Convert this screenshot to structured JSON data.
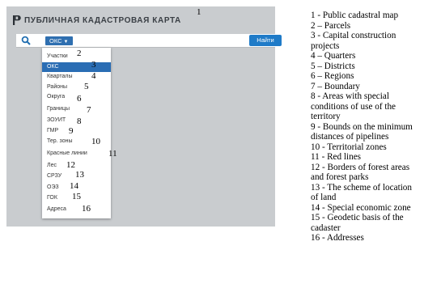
{
  "app": {
    "title": "ПУБЛИЧНАЯ КАДАСТРОВАЯ КАРТА",
    "title_callout": "1"
  },
  "search": {
    "selected_layer": "ОКС",
    "input_value": "",
    "button_label": "Найти"
  },
  "colors": {
    "panel_bg": "#c9cccf",
    "accent": "#1f7bc8",
    "selected_item_bg": "#2a6db4"
  },
  "dropdown": {
    "items": [
      {
        "label": "Участки",
        "callout": "2",
        "selected": false
      },
      {
        "label": "ОКС",
        "callout": "3",
        "selected": true
      },
      {
        "label": "Кварталы",
        "callout": "4",
        "selected": false
      },
      {
        "label": "Районы",
        "callout": "5",
        "selected": false
      },
      {
        "label": "Округа",
        "callout": "6",
        "selected": false
      },
      {
        "label": "Границы",
        "callout": "7",
        "selected": false
      },
      {
        "label": "ЗОУИТ",
        "callout": "8",
        "selected": false
      },
      {
        "label": "ГМР",
        "callout": "9",
        "selected": false
      },
      {
        "label": "Тер. зоны",
        "callout": "10",
        "selected": false
      },
      {
        "label": "Красные линии",
        "callout": "11",
        "selected": false
      },
      {
        "label": "Лес",
        "callout": "12",
        "selected": false
      },
      {
        "label": "СРЗУ",
        "callout": "13",
        "selected": false
      },
      {
        "label": "ОЭЗ",
        "callout": "14",
        "selected": false
      },
      {
        "label": "ГОК",
        "callout": "15",
        "selected": false
      },
      {
        "label": "Адреса",
        "callout": "16",
        "selected": false
      }
    ]
  },
  "legend": {
    "lines": [
      "1 - Public cadastral map",
      "2 – Parcels",
      "3 - Capital construction",
      "projects",
      "4 – Quarters",
      "5 – Districts",
      "6 – Regions",
      "7 – Boundary",
      "8 - Areas with special",
      "conditions of use of the",
      "territory",
      "9 - Bounds on the minimum",
      "distances of pipelines",
      "10 - Territorial zones",
      "11 - Red lines",
      "12 - Borders of forest areas",
      "and forest parks",
      "13 - The scheme of location",
      "of land",
      "14 - Special economic zone",
      "15 - Geodetic basis of the",
      "cadaster",
      "16 - Addresses"
    ]
  }
}
